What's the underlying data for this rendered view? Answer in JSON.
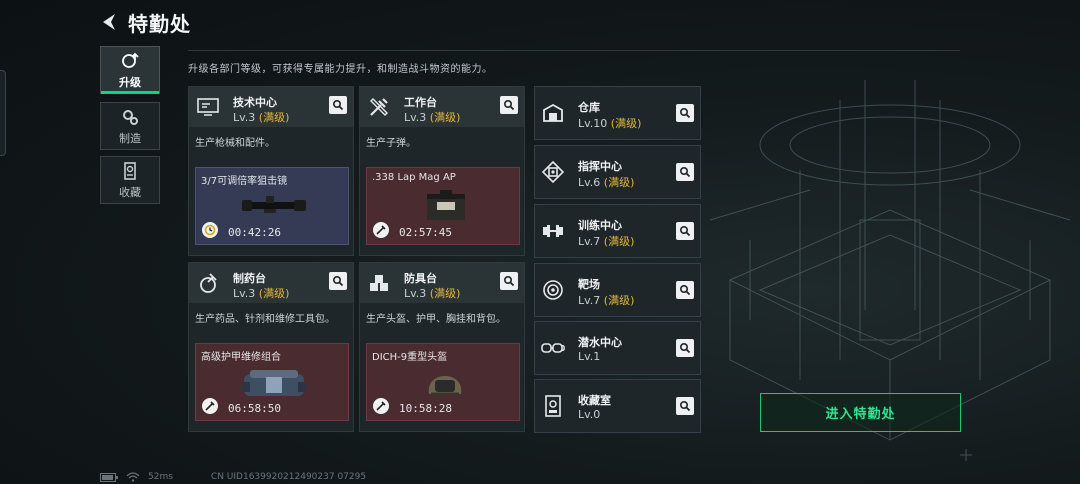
{
  "header": {
    "title": "特勤处"
  },
  "tabs": [
    {
      "label": "升级",
      "icon": "upgrade-icon"
    },
    {
      "label": "制造",
      "icon": "gears-icon"
    },
    {
      "label": "收藏",
      "icon": "collection-icon"
    }
  ],
  "description": "升级各部门等级，可获得专属能力提升，和制造战斗物资的能力。",
  "cards": [
    {
      "name": "技术中心",
      "level": "Lv.3",
      "status": "(满级)",
      "desc": "生产枪械和配件。",
      "item": "3/7可调倍率狙击镜",
      "timer": "00:42:26",
      "icon": "monitor-icon"
    },
    {
      "name": "工作台",
      "level": "Lv.3",
      "status": "(满级)",
      "desc": "生产子弹。",
      "item": ".338 Lap Mag AP",
      "timer": "02:57:45",
      "icon": "tools-icon"
    },
    {
      "name": "制药台",
      "level": "Lv.3",
      "status": "(满级)",
      "desc": "生产药品、针剂和维修工具包。",
      "item": "高级护甲维修组合",
      "timer": "06:58:50",
      "icon": "pharmacy-icon"
    },
    {
      "name": "防具台",
      "level": "Lv.3",
      "status": "(满级)",
      "desc": "生产头盔、护甲、胸挂和背包。",
      "item": "DICH-9重型头盔",
      "timer": "10:58:28",
      "icon": "armor-icon"
    }
  ],
  "facilities": [
    {
      "name": "仓库",
      "level": "Lv.10",
      "status": "(满级)",
      "icon": "warehouse-icon"
    },
    {
      "name": "指挥中心",
      "level": "Lv.6",
      "status": "(满级)",
      "icon": "command-center-icon"
    },
    {
      "name": "训练中心",
      "level": "Lv.7",
      "status": "(满级)",
      "icon": "dumbbell-icon"
    },
    {
      "name": "靶场",
      "level": "Lv.7",
      "status": "(满级)",
      "icon": "target-icon"
    },
    {
      "name": "潜水中心",
      "level": "Lv.1",
      "status": "",
      "icon": "diving-goggles-icon"
    },
    {
      "name": "收藏室",
      "level": "Lv.0",
      "status": "",
      "icon": "collection-room-icon"
    }
  ],
  "enter_button": "进入特勤处",
  "status": {
    "ping": "52ms",
    "uid": "CN UID1639920212490237 07295"
  },
  "colors": {
    "accent_green": "#0fd47c",
    "maxed_gold": "#e0b733",
    "production_purple": "#353a55",
    "production_red": "#4a2b30"
  }
}
